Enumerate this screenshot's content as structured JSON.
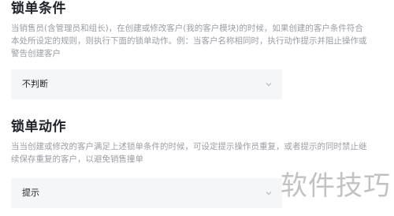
{
  "lock_condition": {
    "title": "锁单条件",
    "description": "当销售员(含管理员和组长)，在创建或修改客户(我的客户模块)的时候，如果创建的客户条件符合本处所设定的规则，则执行下面的锁单动作。例：当客户名称相同时，执行动作提示并阻止操作或警告创建客户",
    "select_value": "不判断"
  },
  "lock_action": {
    "title": "锁单动作",
    "description": "当当创建或修改的客户满足上述锁单条件的时候，可设定提示操作员重复，或者提示的同时禁止继续保存重复的客户，以避免销售撞单",
    "select_value": "提示"
  },
  "watermark": "软件技巧"
}
